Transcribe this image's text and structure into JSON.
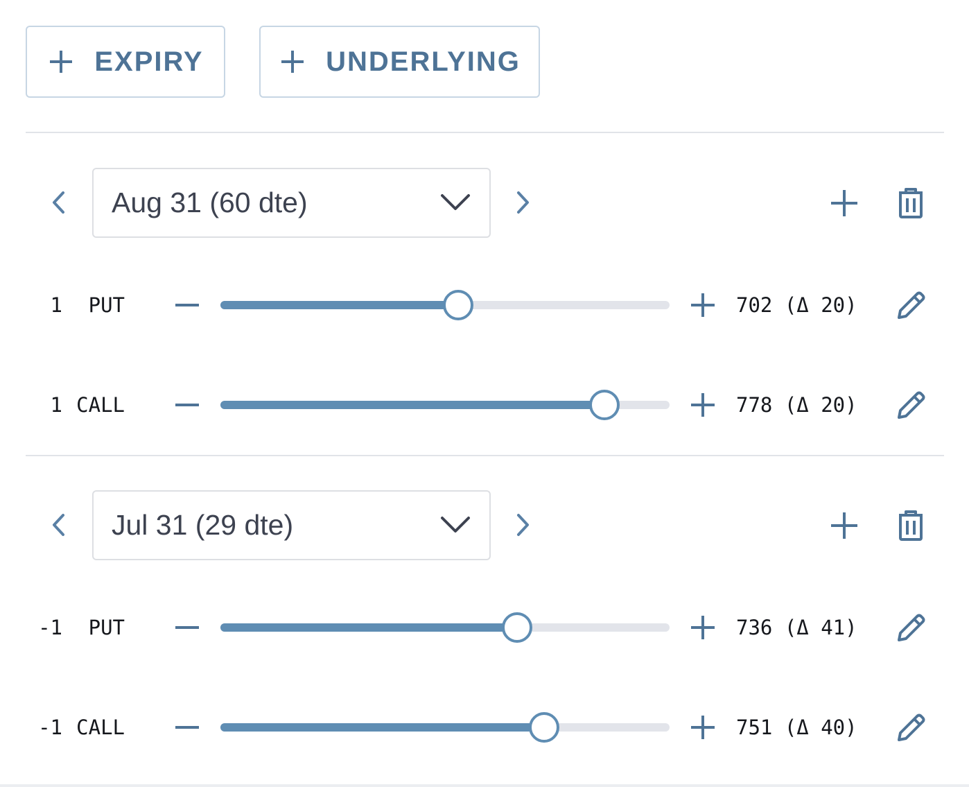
{
  "toolbar": {
    "add_expiry_label": "EXPIRY",
    "add_underlying_label": "UNDERLYING"
  },
  "colors": {
    "accent": "#4e7396",
    "slider_fill": "#5f8db3",
    "slider_track": "#e2e4ea",
    "border": "#c7d6e4"
  },
  "icons": {
    "add": "plus-icon",
    "remove": "minus-icon",
    "prev": "chevron-left-icon",
    "next": "chevron-right-icon",
    "dropdown": "chevron-down-icon",
    "delete": "trash-icon",
    "edit": "pencil-icon"
  },
  "expiries": [
    {
      "selected": "Aug 31 (60 dte)",
      "legs": [
        {
          "qty": "1",
          "type": "PUT",
          "value": "702 (Δ 20)",
          "slider_fraction": 0.53
        },
        {
          "qty": "1",
          "type": "CALL",
          "value": "778 (Δ 20)",
          "slider_fraction": 0.855
        }
      ]
    },
    {
      "selected": "Jul 31 (29 dte)",
      "legs": [
        {
          "qty": "-1",
          "type": "PUT",
          "value": "736 (Δ 41)",
          "slider_fraction": 0.66
        },
        {
          "qty": "-1",
          "type": "CALL",
          "value": "751 (Δ 40)",
          "slider_fraction": 0.72
        }
      ]
    }
  ]
}
